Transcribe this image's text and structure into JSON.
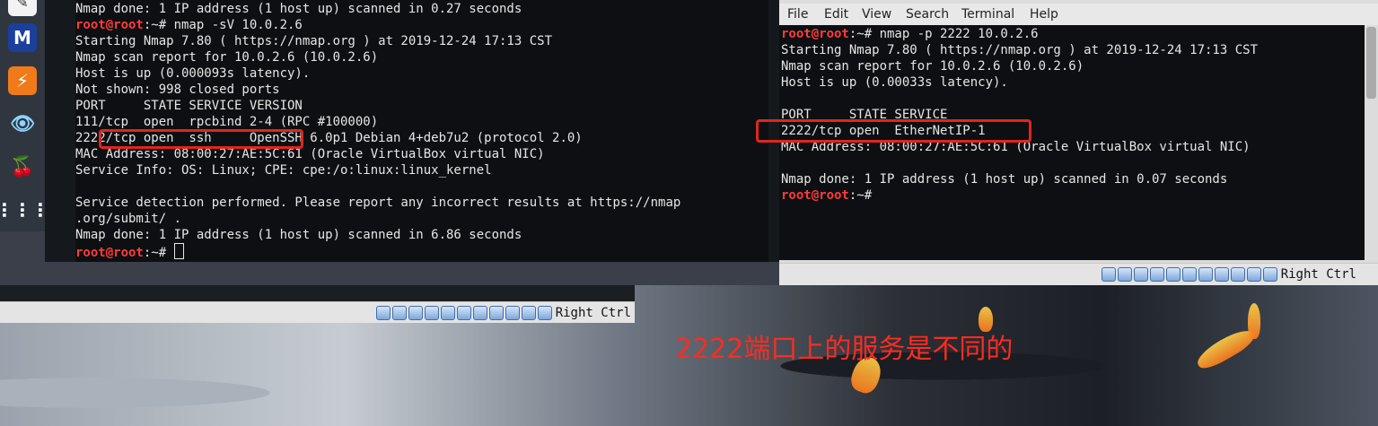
{
  "left_terminal": {
    "lines": [
      {
        "text": "Nmap done: 1 IP address (1 host up) scanned in 0.27 seconds"
      },
      {
        "prompt": "root@root",
        "rest": ":~# nmap -sV 10.0.2.6"
      },
      {
        "text": "Starting Nmap 7.80 ( https://nmap.org ) at 2019-12-24 17:13 CST"
      },
      {
        "text": "Nmap scan report for 10.0.2.6 (10.0.2.6)"
      },
      {
        "text": "Host is up (0.000093s latency)."
      },
      {
        "text": "Not shown: 998 closed ports"
      },
      {
        "text": "PORT     STATE SERVICE VERSION"
      },
      {
        "text": "111/tcp  open  rpcbind 2-4 (RPC #100000)"
      },
      {
        "text": "2222/tcp open  ssh     OpenSSH 6.0p1 Debian 4+deb7u2 (protocol 2.0)"
      },
      {
        "text": "MAC Address: 08:00:27:AE:5C:61 (Oracle VirtualBox virtual NIC)"
      },
      {
        "text": "Service Info: OS: Linux; CPE: cpe:/o:linux:linux_kernel"
      },
      {
        "text": ""
      },
      {
        "text": "Service detection performed. Please report any incorrect results at https://nmap"
      },
      {
        "text": ".org/submit/ ."
      },
      {
        "text": "Nmap done: 1 IP address (1 host up) scanned in 6.86 seconds"
      },
      {
        "prompt": "root@root",
        "rest": ":~# "
      }
    ]
  },
  "right_terminal": {
    "menu": [
      "File",
      "Edit",
      "View",
      "Search",
      "Terminal",
      "Help"
    ],
    "lines": [
      {
        "prompt": "root@root",
        "rest": ":~# nmap -p 2222 10.0.2.6"
      },
      {
        "text": "Starting Nmap 7.80 ( https://nmap.org ) at 2019-12-24 17:13 CST"
      },
      {
        "text": "Nmap scan report for 10.0.2.6 (10.0.2.6)"
      },
      {
        "text": "Host is up (0.00033s latency)."
      },
      {
        "text": ""
      },
      {
        "text": "PORT     STATE SERVICE"
      },
      {
        "text": "2222/tcp open  EtherNetIP-1"
      },
      {
        "text": "MAC Address: 08:00:27:AE:5C:61 (Oracle VirtualBox virtual NIC)"
      },
      {
        "text": ""
      },
      {
        "text": "Nmap done: 1 IP address (1 host up) scanned in 0.07 seconds"
      },
      {
        "prompt": "root@root",
        "rest": ":~# "
      }
    ]
  },
  "statusbar": {
    "host_key_label": "Right Ctrl",
    "icons": [
      "settings-icon",
      "cd-icon",
      "network-icon",
      "network-icon",
      "usb-icon",
      "shared-folder-icon",
      "display-icon",
      "capture-icon",
      "v-icon",
      "globe-icon",
      "arrow-down-icon"
    ]
  },
  "dock": {
    "icons": [
      "editor-icon",
      "malwarebytes-icon",
      "burp-icon",
      "eye-icon",
      "cherry-icon",
      "apps-grid-icon"
    ]
  },
  "annotation": "2222端口上的服务是不同的",
  "colors": {
    "prompt": "#ff3b3b",
    "highlight_box": "#e0261b",
    "annotation": "#ff2b1f"
  }
}
